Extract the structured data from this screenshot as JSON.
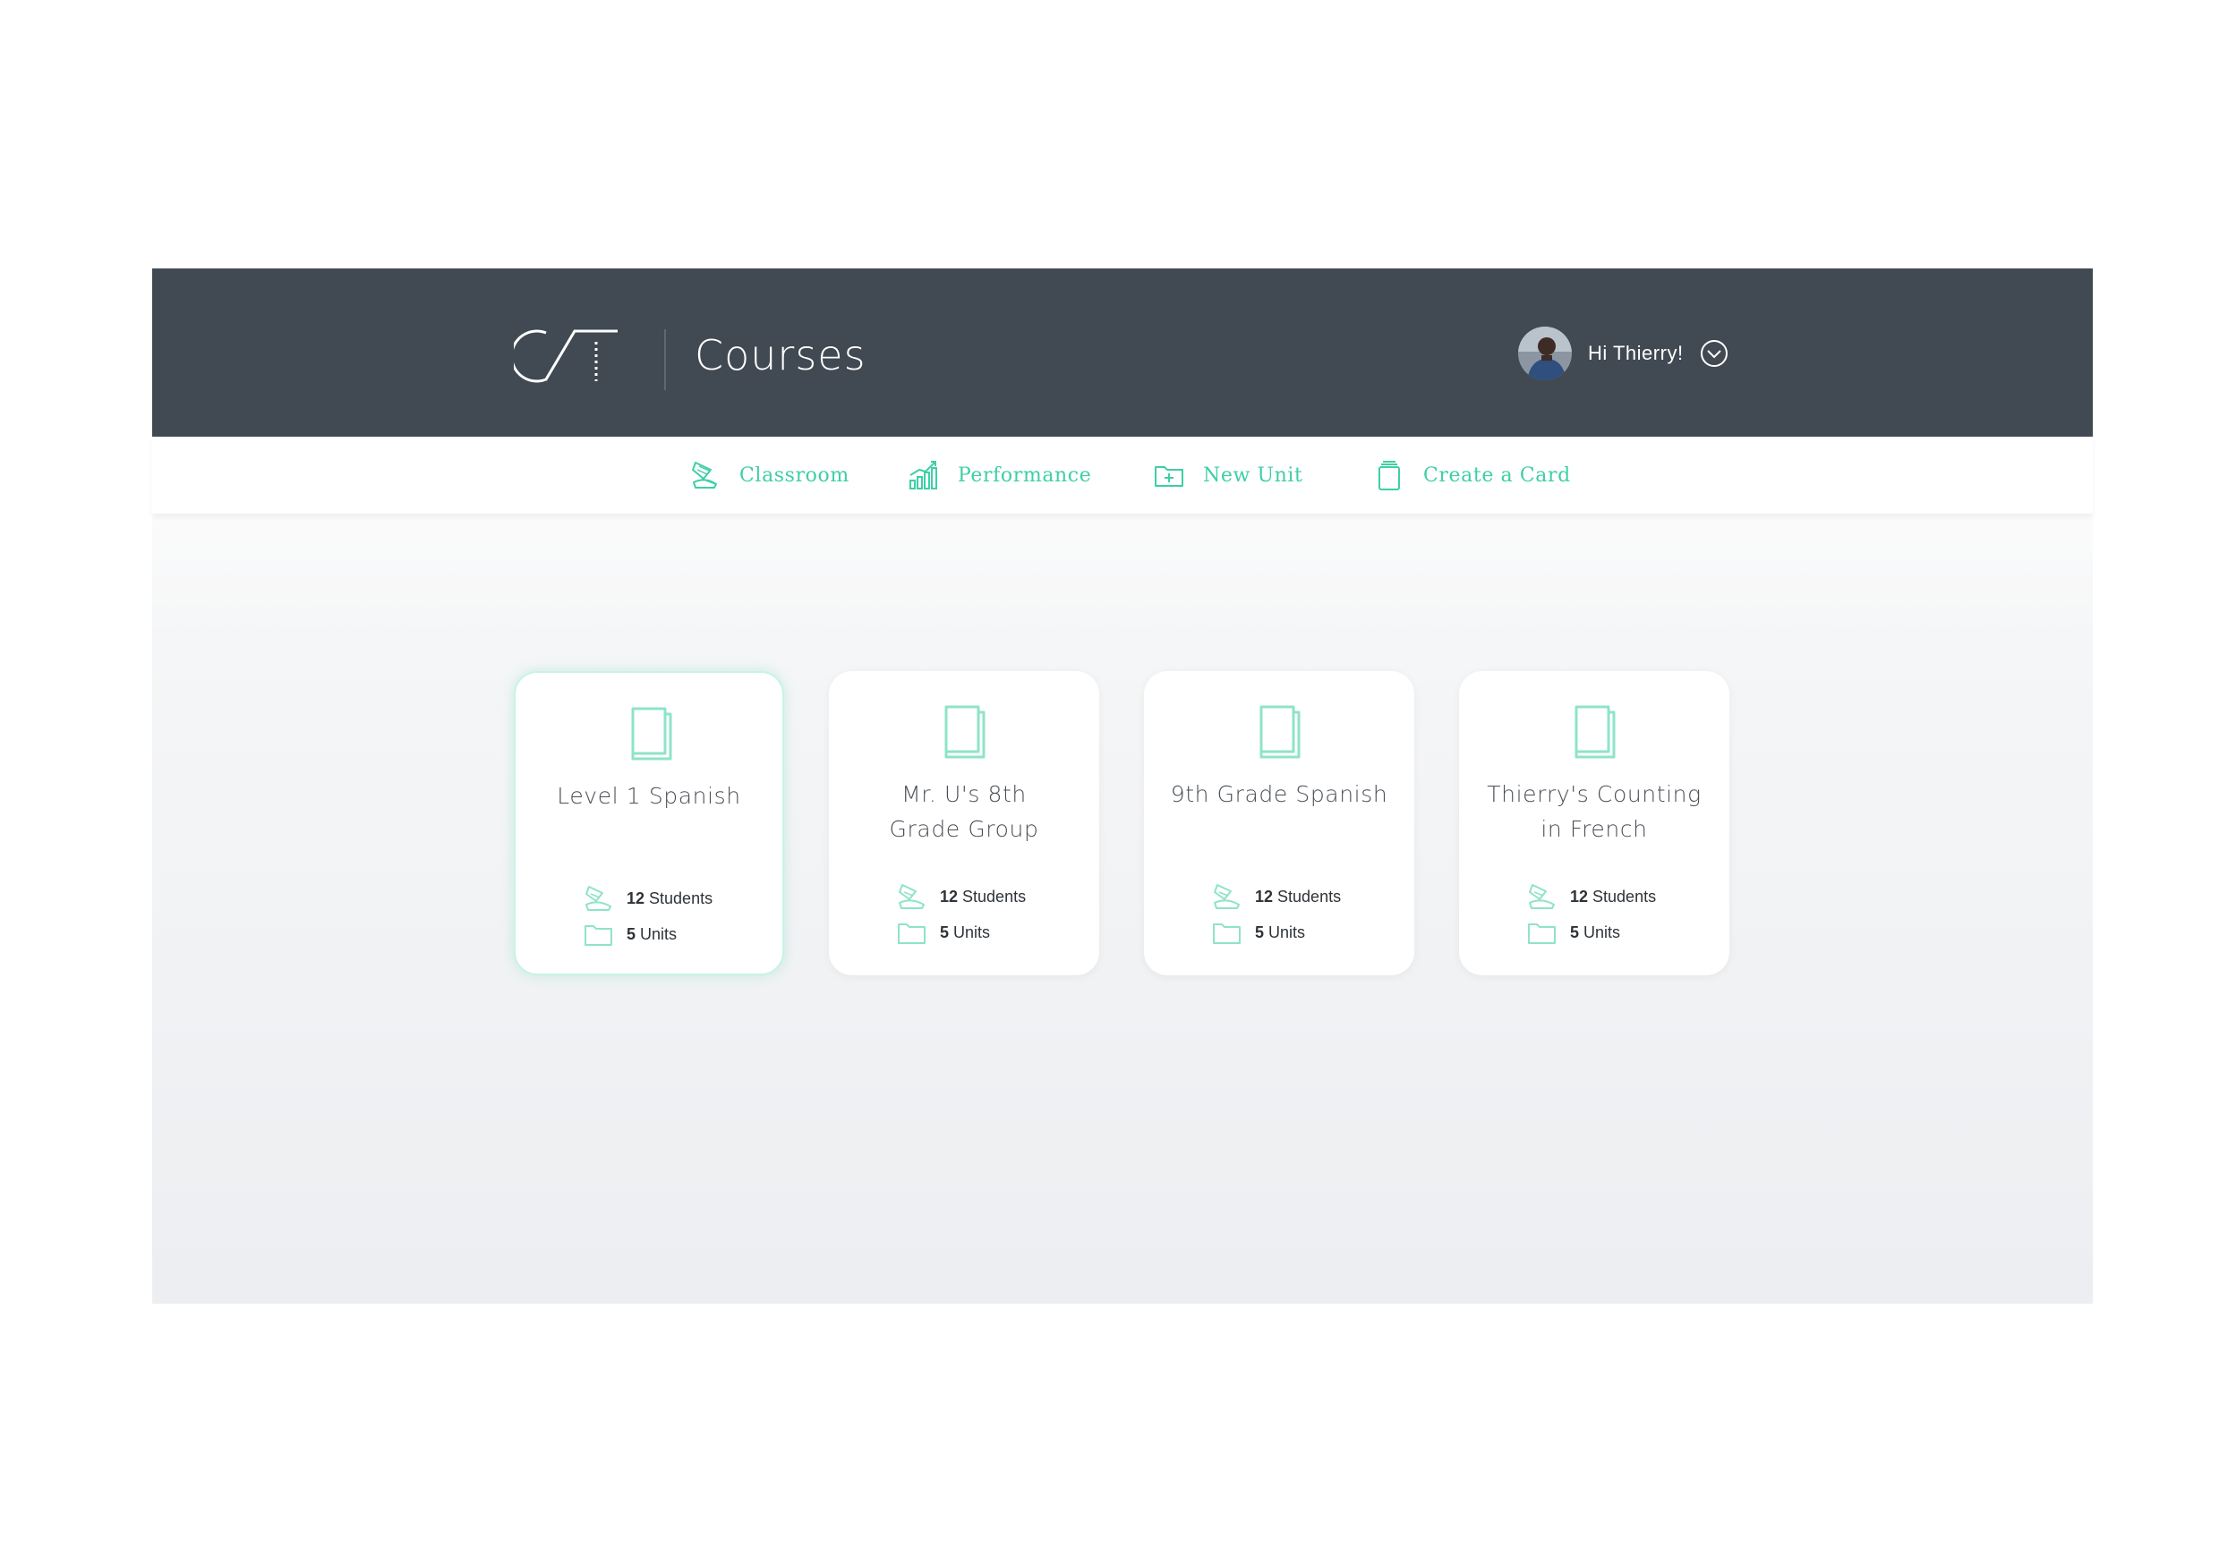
{
  "header": {
    "page_title": "Courses",
    "greeting": "Hi Thierry!"
  },
  "nav": [
    {
      "label": "Classroom",
      "icon": "classroom-icon"
    },
    {
      "label": "Performance",
      "icon": "performance-chart-icon"
    },
    {
      "label": "New Unit",
      "icon": "folder-plus-icon"
    },
    {
      "label": "Create a Card",
      "icon": "cards-icon"
    }
  ],
  "courses": [
    {
      "title_line1": "Level 1 Spanish",
      "title_line2": "",
      "students_count": "12",
      "students_label": "Students",
      "units_count": "5",
      "units_label": "Units",
      "selected": true
    },
    {
      "title_line1": "Mr. U's 8th",
      "title_line2": "Grade Group",
      "students_count": "12",
      "students_label": "Students",
      "units_count": "5",
      "units_label": "Units",
      "selected": false
    },
    {
      "title_line1": "9th Grade Spanish",
      "title_line2": "",
      "students_count": "12",
      "students_label": "Students",
      "units_count": "5",
      "units_label": "Units",
      "selected": false
    },
    {
      "title_line1": "Thierry's Counting",
      "title_line2": "in French",
      "students_count": "12",
      "students_label": "Students",
      "units_count": "5",
      "units_label": "Units",
      "selected": false
    }
  ],
  "colors": {
    "header_bg": "#414952",
    "accent": "#3ecfa6",
    "text_dark": "#4a4f56"
  }
}
